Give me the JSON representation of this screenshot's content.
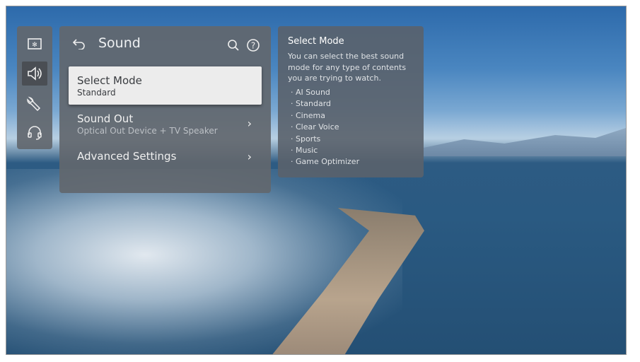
{
  "sidebar": {
    "items": [
      {
        "icon": "picture-icon",
        "label": "Picture"
      },
      {
        "icon": "speaker-icon",
        "label": "Sound",
        "active": true
      },
      {
        "icon": "wrench-icon",
        "label": "General"
      },
      {
        "icon": "headset-icon",
        "label": "Support"
      }
    ]
  },
  "header": {
    "title": "Sound",
    "back_icon": "back-arrow-icon",
    "search_icon": "search-icon",
    "help_icon": "help-icon"
  },
  "menu": {
    "items": [
      {
        "label": "Select Mode",
        "value": "Standard"
      },
      {
        "label": "Sound Out",
        "value": "Optical Out Device + TV Speaker"
      },
      {
        "label": "Advanced Settings"
      }
    ]
  },
  "help_panel": {
    "title": "Select Mode",
    "description": "You can select the best sound mode for any type of contents you are trying to watch.",
    "options": [
      "AI Sound",
      "Standard",
      "Cinema",
      "Clear Voice",
      "Sports",
      "Music",
      "Game Optimizer"
    ]
  },
  "colors": {
    "panel": "#62676e",
    "selected": "#ececec"
  }
}
